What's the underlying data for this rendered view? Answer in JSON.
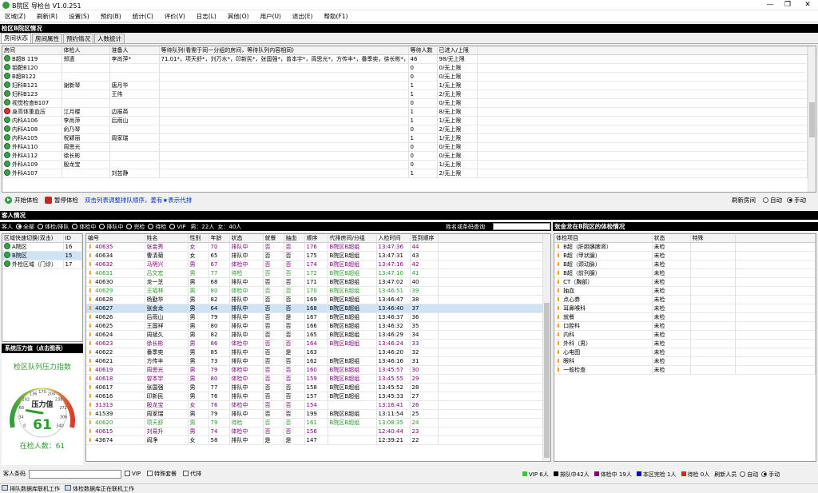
{
  "window": {
    "title": "B院区 导检台  V1.0.251",
    "min": "—",
    "max": "❐",
    "close": "✕"
  },
  "menu": [
    "区域(Z)",
    "刷新(R)",
    "设置(S)",
    "预约(B)",
    "统计(C)",
    "评价(V)",
    "日志(L)",
    "其他(O)",
    "用户(U)",
    "退出(E)",
    "帮助(F1)"
  ],
  "top_banner": "检区B院区情况",
  "tabs": [
    "房间状态",
    "房间属性",
    "预约情况",
    "人数统计"
  ],
  "room_table": {
    "headers": [
      "房间",
      "体检人",
      "准备人",
      "等待队列(看需于同一分组的房间，等待队列内容相同)",
      "等待人数",
      "已进入/上限"
    ],
    "rows": [
      [
        "B超B 119",
        "郑遗",
        "李尚萍*",
        "71.01*，项天舒*，刘万水*，印新民*，张国强*，曾本宇*，周思光*，方传丰*，番季奕，徐长彬*，周 ...",
        "46",
        "98/无上限"
      ],
      [
        "钼靶B120",
        "",
        "",
        "",
        "0",
        "0/无上限"
      ],
      [
        "B超B122",
        "",
        "",
        "",
        "0",
        "0/无上限"
      ],
      [
        "妇科B121",
        "谢新琴",
        "唐月华",
        "",
        "1",
        "1/无上限"
      ],
      [
        "妇科B123",
        "",
        "王伟",
        "",
        "1",
        "2/无上限"
      ],
      [
        "视觉检查B107",
        "",
        "",
        "",
        "0",
        "0/无上限"
      ],
      [
        "身高体重血压",
        "江月楼",
        "边振英",
        "",
        "1",
        "8/无上限"
      ],
      [
        "内科A106",
        "李尚萍",
        "后雨山",
        "",
        "1",
        "1/无上限"
      ],
      [
        "内科A108",
        "俞乃琴",
        "",
        "",
        "0",
        "2/无上限"
      ],
      [
        "内科A105",
        "祝颖丽",
        "周家瑞",
        "",
        "1",
        "1/无上限"
      ],
      [
        "外科A110",
        "周思光",
        "",
        "",
        "0",
        "0/无上限"
      ],
      [
        "外科A112",
        "徐长彬",
        "",
        "",
        "0",
        "0/无上限"
      ],
      [
        "外科A109",
        "殷龙宝",
        "",
        "",
        "0",
        "1/无上限"
      ],
      [
        "外科A107",
        "",
        "刘芸静",
        "",
        "1",
        "2/无上限"
      ]
    ]
  },
  "toolbar": {
    "start": "开始体检",
    "pause": "暂停体检",
    "hint": "双击列表调整排队顺序，姜有★表示代排",
    "refresh_label": "刷新房间",
    "auto": "自动",
    "manual": "手动"
  },
  "guest_banner": "客人情况",
  "filters": {
    "label": "客人",
    "options": [
      "全部",
      "体检/排队",
      "体检中",
      "排队中",
      "完检",
      "待检",
      "VIP"
    ],
    "male": "男：22人",
    "female": "女：40人",
    "search_label": "姓名或条码查询"
  },
  "area_table": {
    "headers": [
      "区域快速切换(双击)",
      "ID"
    ],
    "rows": [
      [
        "A院区",
        "16"
      ],
      [
        "B院区",
        "15"
      ],
      [
        "外检区域（门诊）",
        "17"
      ]
    ]
  },
  "pressure": {
    "banner": "系统压力值（点击图表）",
    "title": "检区队列压力指数",
    "gauge_label": "压力值",
    "value": "61",
    "ticks": [
      "0",
      "34",
      "68",
      "102",
      "136",
      "170",
      "204",
      "238",
      "272",
      "306",
      "340"
    ],
    "in_exam": "在检人数：61"
  },
  "guest_table": {
    "headers": [
      "编号",
      "姓名",
      "性别",
      "年龄",
      "状态",
      "就餐",
      "抽血",
      "顺序",
      "代排房间/分组",
      "入检时间",
      "签到顺序"
    ],
    "rows": [
      [
        "40635",
        "张金秀",
        "女",
        "70",
        "排队中",
        "否",
        "否",
        "176",
        "B院区B超组",
        "13:47:36",
        "44",
        "purple"
      ],
      [
        "40634",
        "曹清菊",
        "女",
        "65",
        "排队中",
        "否",
        "否",
        "175",
        "B院区B超组",
        "13:47:31",
        "43",
        ""
      ],
      [
        "40632",
        "马明兴",
        "男",
        "67",
        "体检中",
        "否",
        "否",
        "174",
        "B院区B超组",
        "13:47:16",
        "42",
        "purple"
      ],
      [
        "40631",
        "吕文宏",
        "男",
        "77",
        "待检",
        "否",
        "否",
        "172",
        "B院区B超组",
        "13:47:10",
        "41",
        "green"
      ],
      [
        "40630",
        "龙一芝",
        "男",
        "68",
        "排队中",
        "否",
        "否",
        "171",
        "B院区B超组",
        "13:47:02",
        "40",
        ""
      ],
      [
        "40629",
        "王福林",
        "男",
        "80",
        "体检中",
        "否",
        "否",
        "170",
        "B院区B超组",
        "13:46:51",
        "39",
        "green"
      ],
      [
        "40628",
        "杨勤华",
        "男",
        "82",
        "排队中",
        "否",
        "否",
        "169",
        "B院区B超组",
        "13:46:47",
        "38",
        ""
      ],
      [
        "40627",
        "张金龙",
        "男",
        "64",
        "排队中",
        "否",
        "否",
        "168",
        "B院区B超组",
        "13:46:40",
        "37",
        "sel"
      ],
      [
        "40626",
        "后雨山",
        "男",
        "79",
        "排队中",
        "否",
        "是",
        "167",
        "B院区B超组",
        "13:46:37",
        "36",
        ""
      ],
      [
        "40625",
        "王国祥",
        "男",
        "80",
        "排队中",
        "否",
        "否",
        "166",
        "B院区B超组",
        "13:46:32",
        "35",
        ""
      ],
      [
        "40624",
        "周斌久",
        "男",
        "82",
        "排队中",
        "否",
        "否",
        "165",
        "B院区B超组",
        "13:46:29",
        "34",
        ""
      ],
      [
        "40623",
        "徐长彬",
        "男",
        "86",
        "体检中",
        "否",
        "否",
        "164",
        "B院区B超组",
        "13:46:24",
        "33",
        "purple"
      ],
      [
        "40622",
        "番季奕",
        "男",
        "85",
        "排队中",
        "否",
        "是",
        "163",
        "",
        "13:46:20",
        "32",
        ""
      ],
      [
        "40621",
        "方传丰",
        "男",
        "73",
        "排队中",
        "否",
        "否",
        "162",
        "B院区B超组",
        "13:46:16",
        "31",
        ""
      ],
      [
        "40619",
        "周思光",
        "男",
        "79",
        "体检中",
        "否",
        "否",
        "160",
        "B院区B超组",
        "13:45:57",
        "30",
        "purple"
      ],
      [
        "40618",
        "曾本宇",
        "男",
        "80",
        "体检中",
        "否",
        "否",
        "159",
        "B院区B超组",
        "13:45:55",
        "29",
        "purple"
      ],
      [
        "40617",
        "张国强",
        "男",
        "77",
        "排队中",
        "否",
        "否",
        "158",
        "B院区B超组",
        "13:45:52",
        "28",
        ""
      ],
      [
        "40616",
        "印新民",
        "男",
        "76",
        "排队中",
        "否",
        "否",
        "157",
        "B院区B超组",
        "13:45:33",
        "27",
        ""
      ],
      [
        "31313",
        "殷龙宝",
        "女",
        "76",
        "体检中",
        "否",
        "否",
        "154",
        "",
        "13:16:41",
        "26",
        "purple"
      ],
      [
        "41539",
        "周家瑞",
        "男",
        "79",
        "排队中",
        "否",
        "否",
        "199",
        "B院区B超组",
        "13:11:54",
        "25",
        ""
      ],
      [
        "40620",
        "项天舒",
        "男",
        "79",
        "待检",
        "否",
        "否",
        "161",
        "B院区B超组",
        "13:08:35",
        "24",
        "green"
      ],
      [
        "40615",
        "刘易升",
        "男",
        "74",
        "体检中",
        "否",
        "否",
        "156",
        "",
        "12:40:44",
        "23",
        "purple"
      ],
      [
        "43674",
        "阎净",
        "女",
        "58",
        "排队中",
        "是",
        "是",
        "147",
        "",
        "12:39:21",
        "22",
        ""
      ]
    ]
  },
  "detail": {
    "banner": "张金龙在B院区的体检情况",
    "headers": [
      "体检项目",
      "状态",
      "特殊"
    ],
    "rows": [
      [
        "B超（肝胆胰脾肾）",
        "未检"
      ],
      [
        "B超（甲状腺）",
        "未检"
      ],
      [
        "B超（颈动脉）",
        "未检"
      ],
      [
        "B超（前列腺）",
        "未检"
      ],
      [
        "CT（胸部）",
        "未检"
      ],
      [
        "抽血",
        "未检"
      ],
      [
        "点心券",
        "未检"
      ],
      [
        "耳鼻喉科",
        "未检"
      ],
      [
        "就餐",
        "未检"
      ],
      [
        "口腔科",
        "未检"
      ],
      [
        "内科",
        "未检"
      ],
      [
        "外科（男）",
        "未检"
      ],
      [
        "心电图",
        "未检"
      ],
      [
        "眼科",
        "未检"
      ],
      [
        "一般检查",
        "未检"
      ]
    ]
  },
  "bottom": {
    "barcode_label": "客人条码",
    "vip": "VIP",
    "special": "特殊套餐",
    "proxy": "代排",
    "refresh_label": "刷新人员",
    "auto": "自动",
    "manual": "手动"
  },
  "legend": [
    {
      "color": "#33cc33",
      "text": "VIP 6人"
    },
    {
      "color": "#000000",
      "text": "排队中42人"
    },
    {
      "color": "#800080",
      "text": "体检中 19人"
    },
    {
      "color": "#0000cc",
      "text": "本区完检 1人"
    },
    {
      "color": "#dd2222",
      "text": "待检 0人"
    }
  ],
  "status": {
    "db1": "排队数据库联机工作",
    "db2": "体检数据库正在联机工作"
  }
}
